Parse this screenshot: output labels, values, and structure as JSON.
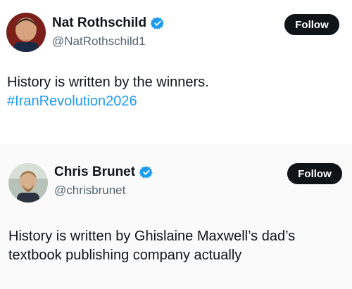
{
  "tweets": [
    {
      "display_name": "Nat Rothschild",
      "handle": "@NatRothschild1",
      "follow_label": "Follow",
      "text": "History is written by the winners.",
      "hashtag": "#IranRevolution2026",
      "verified_icon": "verified-badge-icon",
      "avatar_icon": "avatar-photo"
    },
    {
      "display_name": "Chris Brunet",
      "handle": "@chrisbrunet",
      "follow_label": "Follow",
      "text_line1": "History is written by Ghislaine Maxwell’s dad’s",
      "text_line2": "textbook publishing company actually",
      "verified_icon": "verified-badge-icon",
      "avatar_icon": "avatar-photo"
    }
  ],
  "colors": {
    "link": "#1d9bf0",
    "verified": "#1d9bf0",
    "button_bg": "#0f1419",
    "handle": "#536471"
  }
}
